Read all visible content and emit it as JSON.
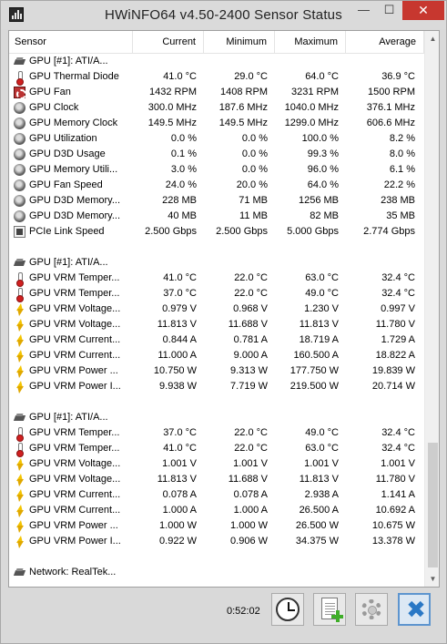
{
  "window": {
    "title": "HWiNFO64 v4.50-2400 Sensor Status",
    "minimize_glyph": "—",
    "maximize_glyph": "☐",
    "close_glyph": "✕"
  },
  "columns": {
    "sensor": "Sensor",
    "current": "Current",
    "minimum": "Minimum",
    "maximum": "Maximum",
    "average": "Average"
  },
  "rows": [
    {
      "icon": "gpu-icon",
      "name": "GPU [#1]: ATI/A...",
      "current": "",
      "minimum": "",
      "maximum": "",
      "average": ""
    },
    {
      "icon": "thermometer-icon",
      "name": "GPU Thermal Diode",
      "current": "41.0 °C",
      "minimum": "29.0 °C",
      "maximum": "64.0 °C",
      "average": "36.9 °C"
    },
    {
      "icon": "fan-icon",
      "name": "GPU Fan",
      "current": "1432 RPM",
      "minimum": "1408 RPM",
      "maximum": "3231 RPM",
      "average": "1500 RPM"
    },
    {
      "icon": "clock-icon",
      "name": "GPU Clock",
      "current": "300.0 MHz",
      "minimum": "187.6 MHz",
      "maximum": "1040.0 MHz",
      "average": "376.1 MHz"
    },
    {
      "icon": "clock-icon",
      "name": "GPU Memory Clock",
      "current": "149.5 MHz",
      "minimum": "149.5 MHz",
      "maximum": "1299.0 MHz",
      "average": "606.6 MHz"
    },
    {
      "icon": "clock-icon",
      "name": "GPU Utilization",
      "current": "0.0 %",
      "minimum": "0.0 %",
      "maximum": "100.0 %",
      "average": "8.2 %"
    },
    {
      "icon": "clock-icon",
      "name": "GPU D3D Usage",
      "current": "0.1 %",
      "minimum": "0.0 %",
      "maximum": "99.3 %",
      "average": "8.0 %"
    },
    {
      "icon": "clock-icon",
      "name": "GPU Memory Utili...",
      "current": "3.0 %",
      "minimum": "0.0 %",
      "maximum": "96.0 %",
      "average": "6.1 %"
    },
    {
      "icon": "clock-icon",
      "name": "GPU Fan Speed",
      "current": "24.0 %",
      "minimum": "20.0 %",
      "maximum": "64.0 %",
      "average": "22.2 %"
    },
    {
      "icon": "clock-icon",
      "name": "GPU D3D Memory...",
      "current": "228 MB",
      "minimum": "71 MB",
      "maximum": "1256 MB",
      "average": "238 MB"
    },
    {
      "icon": "clock-icon",
      "name": "GPU D3D Memory...",
      "current": "40 MB",
      "minimum": "11 MB",
      "maximum": "82 MB",
      "average": "35 MB"
    },
    {
      "icon": "link-icon",
      "name": "PCIe Link Speed",
      "current": "2.500 Gbps",
      "minimum": "2.500 Gbps",
      "maximum": "5.000 Gbps",
      "average": "2.774 Gbps"
    },
    {
      "icon": "",
      "name": "",
      "current": "",
      "minimum": "",
      "maximum": "",
      "average": ""
    },
    {
      "icon": "gpu-icon",
      "name": "GPU [#1]: ATI/A...",
      "current": "",
      "minimum": "",
      "maximum": "",
      "average": ""
    },
    {
      "icon": "thermometer-icon",
      "name": "GPU VRM Temper...",
      "current": "41.0 °C",
      "minimum": "22.0 °C",
      "maximum": "63.0 °C",
      "average": "32.4 °C"
    },
    {
      "icon": "thermometer-icon",
      "name": "GPU VRM Temper...",
      "current": "37.0 °C",
      "minimum": "22.0 °C",
      "maximum": "49.0 °C",
      "average": "32.4 °C"
    },
    {
      "icon": "lightning-icon",
      "name": "GPU VRM Voltage...",
      "current": "0.979 V",
      "minimum": "0.968 V",
      "maximum": "1.230 V",
      "average": "0.997 V"
    },
    {
      "icon": "lightning-icon",
      "name": "GPU VRM Voltage...",
      "current": "11.813 V",
      "minimum": "11.688 V",
      "maximum": "11.813 V",
      "average": "11.780 V"
    },
    {
      "icon": "lightning-icon",
      "name": "GPU VRM Current...",
      "current": "0.844 A",
      "minimum": "0.781 A",
      "maximum": "18.719 A",
      "average": "1.729 A"
    },
    {
      "icon": "lightning-icon",
      "name": "GPU VRM Current...",
      "current": "11.000 A",
      "minimum": "9.000 A",
      "maximum": "160.500 A",
      "average": "18.822 A"
    },
    {
      "icon": "lightning-icon",
      "name": "GPU VRM Power ...",
      "current": "10.750 W",
      "minimum": "9.313 W",
      "maximum": "177.750 W",
      "average": "19.839 W"
    },
    {
      "icon": "lightning-icon",
      "name": "GPU VRM Power I...",
      "current": "9.938 W",
      "minimum": "7.719 W",
      "maximum": "219.500 W",
      "average": "20.714 W"
    },
    {
      "icon": "",
      "name": "",
      "current": "",
      "minimum": "",
      "maximum": "",
      "average": ""
    },
    {
      "icon": "gpu-icon",
      "name": "GPU [#1]: ATI/A...",
      "current": "",
      "minimum": "",
      "maximum": "",
      "average": ""
    },
    {
      "icon": "thermometer-icon",
      "name": "GPU VRM Temper...",
      "current": "37.0 °C",
      "minimum": "22.0 °C",
      "maximum": "49.0 °C",
      "average": "32.4 °C"
    },
    {
      "icon": "thermometer-icon",
      "name": "GPU VRM Temper...",
      "current": "41.0 °C",
      "minimum": "22.0 °C",
      "maximum": "63.0 °C",
      "average": "32.4 °C"
    },
    {
      "icon": "lightning-icon",
      "name": "GPU VRM Voltage...",
      "current": "1.001 V",
      "minimum": "1.001 V",
      "maximum": "1.001 V",
      "average": "1.001 V"
    },
    {
      "icon": "lightning-icon",
      "name": "GPU VRM Voltage...",
      "current": "11.813 V",
      "minimum": "11.688 V",
      "maximum": "11.813 V",
      "average": "11.780 V"
    },
    {
      "icon": "lightning-icon",
      "name": "GPU VRM Current...",
      "current": "0.078 A",
      "minimum": "0.078 A",
      "maximum": "2.938 A",
      "average": "1.141 A"
    },
    {
      "icon": "lightning-icon",
      "name": "GPU VRM Current...",
      "current": "1.000 A",
      "minimum": "1.000 A",
      "maximum": "26.500 A",
      "average": "10.692 A"
    },
    {
      "icon": "lightning-icon",
      "name": "GPU VRM Power ...",
      "current": "1.000 W",
      "minimum": "1.000 W",
      "maximum": "26.500 W",
      "average": "10.675 W"
    },
    {
      "icon": "lightning-icon",
      "name": "GPU VRM Power I...",
      "current": "0.922 W",
      "minimum": "0.906 W",
      "maximum": "34.375 W",
      "average": "13.378 W"
    },
    {
      "icon": "",
      "name": "",
      "current": "",
      "minimum": "",
      "maximum": "",
      "average": ""
    },
    {
      "icon": "network-icon",
      "name": "Network: RealTek...",
      "current": "",
      "minimum": "",
      "maximum": "",
      "average": ""
    }
  ],
  "scrollbar": {
    "up_glyph": "▲",
    "down_glyph": "▼"
  },
  "toolbar": {
    "elapsed_time": "0:52:02",
    "exit_glyph": "✖"
  }
}
